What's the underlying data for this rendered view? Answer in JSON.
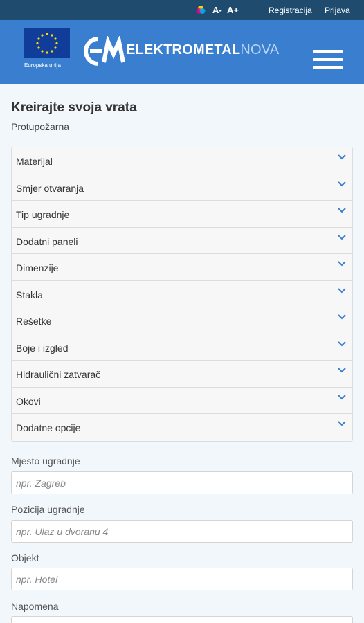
{
  "topbar": {
    "font_decrease": "A-",
    "font_increase": "A+",
    "register": "Registracija",
    "login": "Prijava"
  },
  "header": {
    "eu_caption": "Europska unija",
    "brand_main": "ELEKTROMETAL",
    "brand_suffix": "NOVA",
    "colors": {
      "topbar": "#1f4c6e",
      "header": "#3a7fcf",
      "eu_blue": "#0f3d99",
      "eu_stars": "#ffdd00"
    }
  },
  "page": {
    "title": "Kreirajte svoja vrata",
    "subtitle": "Protupožarna"
  },
  "accordion": [
    {
      "label": "Materijal"
    },
    {
      "label": "Smjer otvaranja"
    },
    {
      "label": "Tip ugradnje"
    },
    {
      "label": "Dodatni paneli"
    },
    {
      "label": "Dimenzije"
    },
    {
      "label": "Stakla"
    },
    {
      "label": "Rešetke"
    },
    {
      "label": "Boje i izgled"
    },
    {
      "label": "Hidraulični zatvarač"
    },
    {
      "label": "Okovi"
    },
    {
      "label": "Dodatne opcije"
    }
  ],
  "form": {
    "location": {
      "label": "Mjesto ugradnje",
      "placeholder": "npr. Zagreb",
      "value": ""
    },
    "position": {
      "label": "Pozicija ugradnje",
      "placeholder": "npr. Ulaz u dvoranu 4",
      "value": ""
    },
    "object": {
      "label": "Objekt",
      "placeholder": "npr. Hotel",
      "value": ""
    },
    "note": {
      "label": "Napomena",
      "placeholder": "",
      "value": ""
    }
  }
}
